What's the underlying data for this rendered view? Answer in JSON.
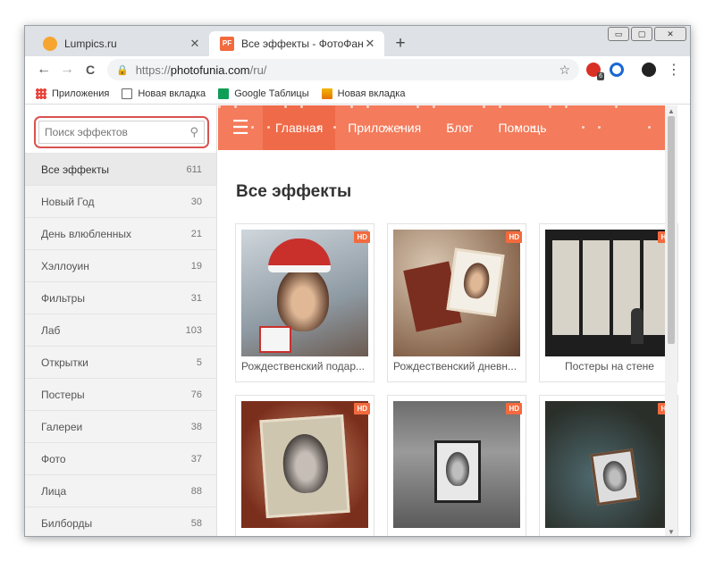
{
  "browser": {
    "tabs": [
      {
        "title": "Lumpics.ru",
        "favicon": "lumpics-favicon",
        "active": false
      },
      {
        "title": "Все эффекты - ФотоФания: Сер",
        "favicon": "photofunia-favicon",
        "active": true
      }
    ],
    "close_glyph": "✕",
    "new_tab_glyph": "+",
    "window_controls": {
      "minimize": "▭",
      "maximize": "▢",
      "close": "✕"
    },
    "nav": {
      "back": "←",
      "forward": "→",
      "reload": "C"
    },
    "url_scheme": "https://",
    "url_host": "photofunia.com",
    "url_path": "/ru/",
    "extension_badge": "6",
    "bookmarks": [
      {
        "label": "Приложения",
        "icon": "apps-grid-icon"
      },
      {
        "label": "Новая вкладка",
        "icon": "page-icon"
      },
      {
        "label": "Google Таблицы",
        "icon": "sheets-icon"
      },
      {
        "label": "Новая вкладка",
        "icon": "image-icon"
      }
    ]
  },
  "sidebar": {
    "search_placeholder": "Поиск эффектов",
    "categories": [
      {
        "label": "Все эффекты",
        "count": "611",
        "active": true
      },
      {
        "label": "Новый Год",
        "count": "30"
      },
      {
        "label": "День влюбленных",
        "count": "21"
      },
      {
        "label": "Хэллоуин",
        "count": "19"
      },
      {
        "label": "Фильтры",
        "count": "31"
      },
      {
        "label": "Лаб",
        "count": "103"
      },
      {
        "label": "Открытки",
        "count": "5"
      },
      {
        "label": "Постеры",
        "count": "76"
      },
      {
        "label": "Галереи",
        "count": "38"
      },
      {
        "label": "Фото",
        "count": "37"
      },
      {
        "label": "Лица",
        "count": "88"
      },
      {
        "label": "Билборды",
        "count": "58"
      }
    ]
  },
  "navbar": {
    "links": [
      "Главная",
      "Приложения",
      "Блог",
      "Помощь"
    ],
    "accent_color": "#f47b5b"
  },
  "main": {
    "heading": "Все эффекты",
    "hd_badge": "HD",
    "effects": [
      {
        "caption": "Рождественский подар..."
      },
      {
        "caption": "Рождественский дневн..."
      },
      {
        "caption": "Постеры на стене"
      },
      {
        "caption": ""
      },
      {
        "caption": ""
      },
      {
        "caption": ""
      }
    ]
  }
}
